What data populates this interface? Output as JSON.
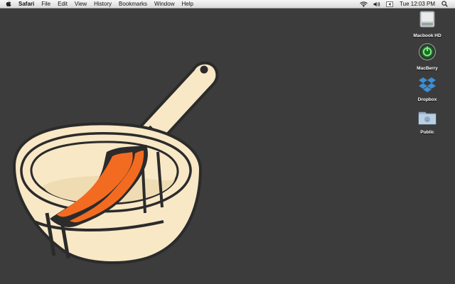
{
  "menubar": {
    "apple_icon": "apple-icon",
    "app_name": "Safari",
    "menus": [
      "File",
      "Edit",
      "View",
      "History",
      "Bookmarks",
      "Window",
      "Help"
    ],
    "status": {
      "icons": [
        "wifi-icon",
        "volume-icon",
        "input-source-icon"
      ],
      "clock": "Tue 12:03 PM",
      "spotlight_icon": "spotlight-search-icon"
    }
  },
  "desktop": {
    "icons": [
      {
        "label": "Macbook HD",
        "icon": "hard-drive-icon"
      },
      {
        "label": "MacBerry",
        "icon": "macberry-icon"
      },
      {
        "label": "Dropbox",
        "icon": "dropbox-icon"
      },
      {
        "label": "Public",
        "icon": "public-folder-icon"
      }
    ],
    "wallpaper": {
      "subject": "frying-pan-with-bacon",
      "background_color": "#3b3c3b",
      "pan_color": "#f8e8c6",
      "outline_color": "#2b2b2b",
      "bacon_color": "#f26b21"
    }
  }
}
